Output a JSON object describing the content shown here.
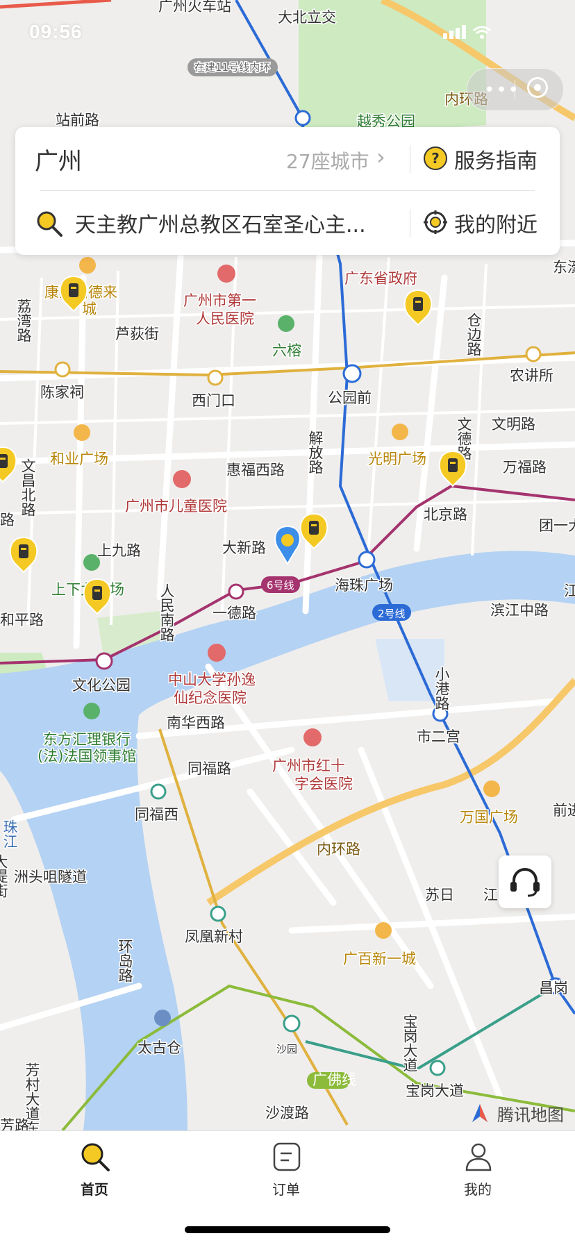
{
  "status_bar": {
    "time": "09:56",
    "battery": ""
  },
  "map": {
    "labels": [
      {
        "t": "广州火车站",
        "c": "#333"
      },
      {
        "t": "大北立交",
        "c": "#333"
      },
      {
        "t": "在建11号线内环",
        "c": "#666"
      },
      {
        "t": "站前路",
        "c": "#333"
      },
      {
        "t": "越秀公园",
        "c": "#2e7d32"
      },
      {
        "t": "内环路",
        "c": "#7a5b14"
      },
      {
        "t": "荔湾路",
        "c": "#333"
      },
      {
        "t": "康王柏德来",
        "c": "#b8860b"
      },
      {
        "t": "城",
        "c": "#b8860b"
      },
      {
        "t": "广州市第一",
        "c": "#b03a3a"
      },
      {
        "t": "人民医院",
        "c": "#b03a3a"
      },
      {
        "t": "广东省政府",
        "c": "#b03a3a"
      },
      {
        "t": "芦荻街",
        "c": "#333"
      },
      {
        "t": "六榕",
        "c": "#2e7d32"
      },
      {
        "t": "仓边路",
        "c": "#333"
      },
      {
        "t": "东濠",
        "c": "#333"
      },
      {
        "t": "陈家祠",
        "c": "#333"
      },
      {
        "t": "西门口",
        "c": "#333"
      },
      {
        "t": "公园前",
        "c": "#333"
      },
      {
        "t": "农讲所",
        "c": "#333"
      },
      {
        "t": "文德路",
        "c": "#333"
      },
      {
        "t": "解放路",
        "c": "#333"
      },
      {
        "t": "文明路",
        "c": "#333"
      },
      {
        "t": "文昌北路",
        "c": "#333"
      },
      {
        "t": "和业广场",
        "c": "#b8860b"
      },
      {
        "t": "惠福西路",
        "c": "#333"
      },
      {
        "t": "光明广场",
        "c": "#b8860b"
      },
      {
        "t": "万福路",
        "c": "#333"
      },
      {
        "t": "广州市儿童医院",
        "c": "#b03a3a"
      },
      {
        "t": "北京路",
        "c": "#333"
      },
      {
        "t": "团一大",
        "c": "#333"
      },
      {
        "t": "路",
        "c": "#333"
      },
      {
        "t": "上九路",
        "c": "#333"
      },
      {
        "t": "大新路",
        "c": "#333"
      },
      {
        "t": "人民南路",
        "c": "#333"
      },
      {
        "t": "上下九广场",
        "c": "#2e7d32"
      },
      {
        "t": "海珠广场",
        "c": "#333"
      },
      {
        "t": "6号线",
        "c": "#fff"
      },
      {
        "t": "一德路",
        "c": "#333"
      },
      {
        "t": "和平路",
        "c": "#333"
      },
      {
        "t": "2号线",
        "c": "#fff"
      },
      {
        "t": "滨江中路",
        "c": "#333"
      },
      {
        "t": "江",
        "c": "#333"
      },
      {
        "t": "文化公园",
        "c": "#333"
      },
      {
        "t": "中山大学孙逸",
        "c": "#b03a3a"
      },
      {
        "t": "仙纪念医院",
        "c": "#b03a3a"
      },
      {
        "t": "小港路",
        "c": "#333"
      },
      {
        "t": "东方汇理银行",
        "c": "#2e7d32"
      },
      {
        "t": "(法)法国领事馆",
        "c": "#2e7d32"
      },
      {
        "t": "南华西路",
        "c": "#333"
      },
      {
        "t": "市二宫",
        "c": "#333"
      },
      {
        "t": "同福路",
        "c": "#333"
      },
      {
        "t": "广州市红十",
        "c": "#b03a3a"
      },
      {
        "t": "字会医院",
        "c": "#b03a3a"
      },
      {
        "t": "珠江",
        "c": "#3a6fb0"
      },
      {
        "t": "同福西",
        "c": "#333"
      },
      {
        "t": "万国广场",
        "c": "#b8860b"
      },
      {
        "t": "前进",
        "c": "#333"
      },
      {
        "t": "内环路",
        "c": "#7a5b14"
      },
      {
        "t": "洲头咀隧道",
        "c": "#333"
      },
      {
        "t": "大堤街",
        "c": "#333"
      },
      {
        "t": "苏日",
        "c": "#333"
      },
      {
        "t": "江",
        "c": "#333"
      },
      {
        "t": "凤凰新村",
        "c": "#333"
      },
      {
        "t": "环岛路",
        "c": "#333"
      },
      {
        "t": "广百新一城",
        "c": "#b8860b"
      },
      {
        "t": "宝岗大道",
        "c": "#333"
      },
      {
        "t": "昌岗",
        "c": "#333"
      },
      {
        "t": "芳村大道东",
        "c": "#333"
      },
      {
        "t": "太古仓",
        "c": "#333"
      },
      {
        "t": "沙园",
        "c": "#333"
      },
      {
        "t": "广佛线",
        "c": "#fff"
      },
      {
        "t": "宝岗大道",
        "c": "#333"
      },
      {
        "t": "沙渡路",
        "c": "#333"
      },
      {
        "t": "芳路",
        "c": "#333"
      }
    ],
    "locker_count": 9,
    "colors": {
      "water": "#b4d2f3",
      "park": "#cdeac0",
      "road": "#ffffff",
      "ring": "#f7c86a",
      "metro2": "#2c6bd6",
      "metro6": "#a4336e",
      "metro1": "#e0b13f",
      "metro_gf": "#8cbb3b"
    }
  },
  "top_card": {
    "city": "广州",
    "city_count": "27座城市",
    "service_guide": "服务指南",
    "search_value": "天主教广州总教区石室圣心主...",
    "nearby": "我的附近"
  },
  "map_brand": "腾讯地图",
  "tabs": [
    {
      "label": "首页",
      "icon": "search-icon",
      "active": true
    },
    {
      "label": "订单",
      "icon": "order-icon",
      "active": false
    },
    {
      "label": "我的",
      "icon": "profile-icon",
      "active": false
    }
  ],
  "accent_color": "#f5c924"
}
